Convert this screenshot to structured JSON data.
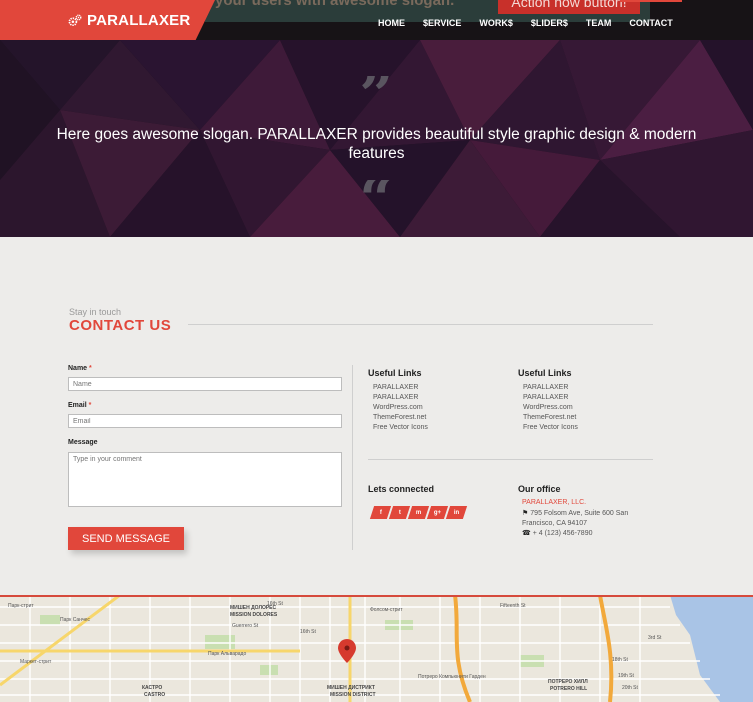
{
  "header": {
    "logo": "PARALLAXER",
    "peek_text": "your users with awesome slogan.",
    "peek_button": "Action now button!",
    "nav": [
      "HOME",
      "$ERVICE",
      "WORK$",
      "$LIDER$",
      "TEAM",
      "CONTACT"
    ],
    "active_nav": "CONTACT"
  },
  "slogan": {
    "quote_open": "”",
    "quote_close": "“",
    "text": "Here goes awesome slogan. PARALLAXER provides beautiful style graphic design & modern features"
  },
  "contact": {
    "eyebrow": "Stay in touch",
    "title": "CONTACT US",
    "form": {
      "name_label": "Name",
      "name_placeholder": "Name",
      "email_label": "Email",
      "email_placeholder": "Email",
      "required_mark": "*",
      "message_label": "Message",
      "message_placeholder": "Type in your comment",
      "send_button": "SEND MESSAGE"
    },
    "useful_links_1": {
      "heading": "Useful Links",
      "items": [
        "PARALLAXER",
        "PARALLAXER",
        "WordPress.com",
        "ThemeForest.net",
        "Free Vector Icons"
      ]
    },
    "useful_links_2": {
      "heading": "Useful Links",
      "items": [
        "PARALLAXER",
        "PARALLAXER",
        "WordPress.com",
        "ThemeForest.net",
        "Free Vector Icons"
      ]
    },
    "connected": {
      "heading": "Lets connected",
      "socials": [
        "f",
        "t",
        "m",
        "g+",
        "in"
      ]
    },
    "office": {
      "heading": "Our office",
      "company": "PARALLAXER, LLC.",
      "address_line1": "795 Folsom Ave, Suite 600 San",
      "address_line2": "Francisco, CA 94107",
      "phone": "+ 4 (123) 456-7890",
      "pin_icon": "⚑",
      "phone_icon": "☎"
    }
  },
  "map": {
    "labels": [
      "16th St",
      "16th St",
      "Парк Санчес",
      "МИШЕН ДОЛОРЕС",
      "MISSION DOLORES",
      "Парк-стрит",
      "КАСТРО",
      "CASTRO",
      "Маркет-стрит",
      "Фолсом-стрит",
      "МИШЕН ДИСТРИКТ",
      "MISSION DISTRICT",
      "ПОТРЕРО ХИЛЛ",
      "POTRERO HILL",
      "Потреро Компьюнити Гарден",
      "Парк Альварадо",
      "18th St",
      "20th St",
      "19th St",
      "3rd St",
      "Fifteenth St",
      "Guerrero St"
    ],
    "brand_color": "#e1473b"
  },
  "colors": {
    "accent": "#e1473b",
    "header_bg": "#171316",
    "slogan_bg": "#1e1220",
    "section_bg": "#edecea"
  }
}
